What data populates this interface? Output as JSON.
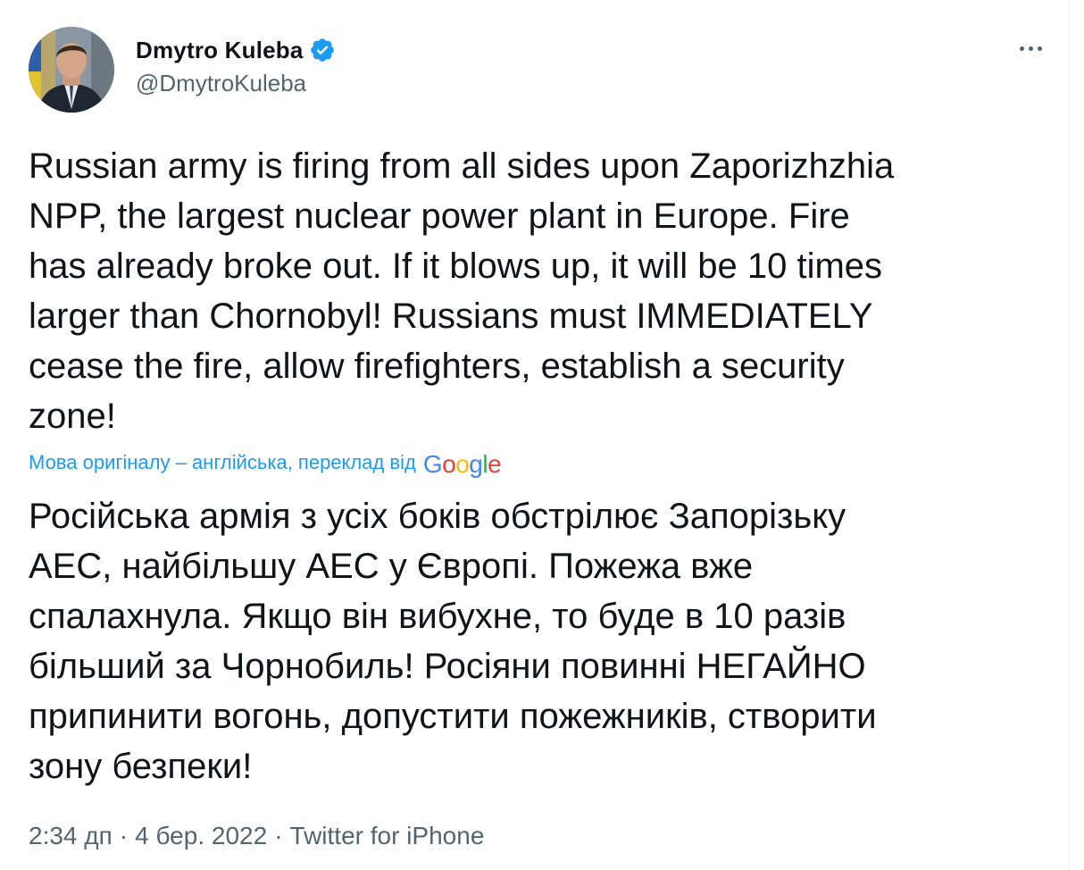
{
  "author": {
    "display_name": "Dmytro Kuleba",
    "handle": "@DmytroKuleba",
    "verified": true,
    "verified_icon": "verified-badge-icon",
    "avatar": "profile-photo"
  },
  "menu": {
    "more_icon": "more-options-icon"
  },
  "tweet": {
    "text": "Russian army is firing from all sides upon Zaporizhzhia\nNPP, the largest nuclear power plant in Europe. Fire\nhas already broke out. If it blows up, it will be 10 times\nlarger than Chornobyl! Russians must IMMEDIATELY\ncease the fire, allow firefighters, establish a security\nzone!",
    "translation_label": "Мова оригіналу – англійська, переклад від",
    "translation_provider": "Google",
    "translated_text": "Російська армія з усіх боків обстрілює Запорізьку\nАЕС, найбільшу АЕС у Європі. Пожежа вже\nспалахнула. Якщо він вибухне, то буде в 10 разів\nбільший за Чорнобиль! Росіяни повинні НЕГАЙНО\nприпинити вогонь, допустити пожежників, створити\nзону безпеки!"
  },
  "meta": {
    "time": "2:34 дп",
    "separator": "·",
    "date": "4 бер. 2022",
    "source": "Twitter for iPhone"
  },
  "colors": {
    "accent": "#1d9bf0",
    "text_primary": "#0f1419",
    "text_secondary": "#536471",
    "google_blue": "#4285f4",
    "google_red": "#ea4335",
    "google_yellow": "#fbbc05",
    "google_green": "#34a853"
  }
}
